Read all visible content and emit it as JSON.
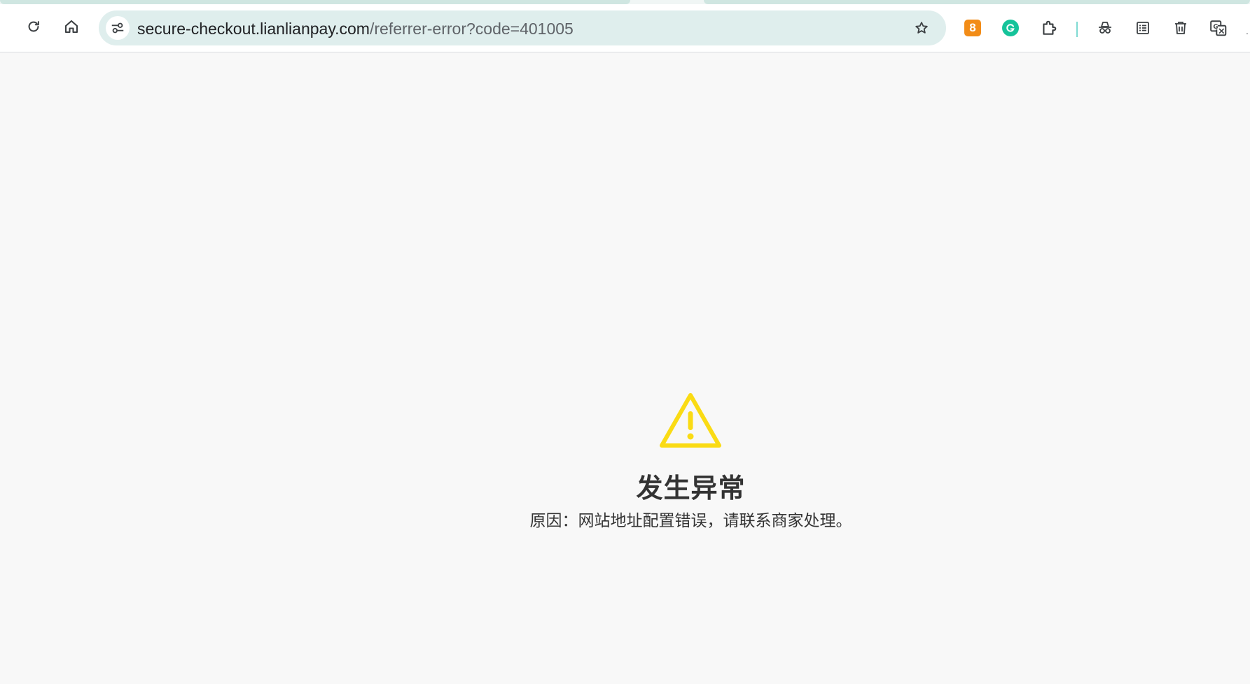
{
  "browser": {
    "address_bar": {
      "host": "secure-checkout.lianlianpay.com",
      "path": "/referrer-error?code=401005"
    },
    "extensions": {
      "badge_count": "8"
    }
  },
  "page": {
    "title": "发生异常",
    "reason": "原因：网站地址配置错误，请联系商家处理。",
    "warning_color": "#fadb14",
    "text_color": "#333333"
  }
}
